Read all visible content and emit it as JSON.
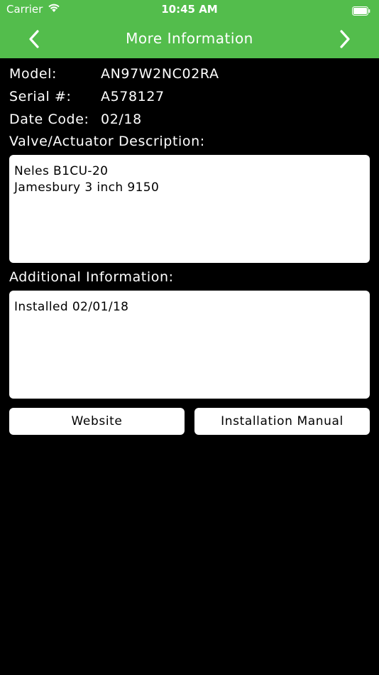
{
  "status_bar": {
    "carrier": "Carrier",
    "time": "10:45 AM"
  },
  "nav": {
    "title": "More Information",
    "back_icon": "chevron-left-icon",
    "next_icon": "chevron-right-icon"
  },
  "details": {
    "model_label": "Model:",
    "model_value": "AN97W2NC02RA",
    "serial_label": "Serial #:",
    "serial_value": "A578127",
    "date_code_label": "Date Code:",
    "date_code_value": "02/18"
  },
  "description": {
    "label": "Valve/Actuator Description:",
    "value": "Neles B1CU-20\nJamesbury 3 inch 9150"
  },
  "additional": {
    "label": "Additional Information:",
    "value": "Installed 02/01/18"
  },
  "buttons": {
    "website": "Website",
    "installation_manual": "Installation Manual"
  },
  "colors": {
    "header": "#53bd4c",
    "background": "#000000",
    "field": "#ffffff"
  }
}
